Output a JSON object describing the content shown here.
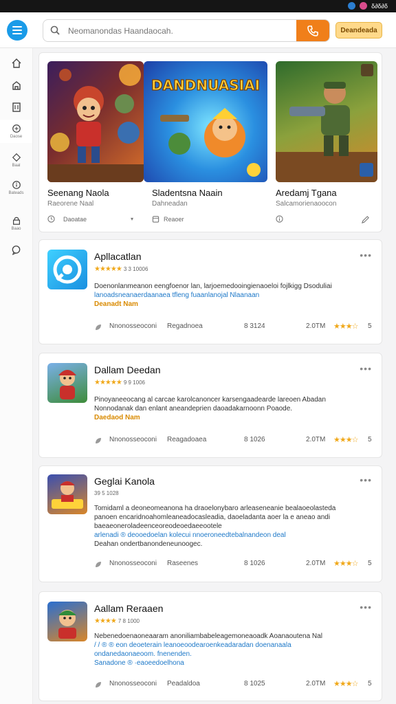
{
  "colors": {
    "accent": "#1a9be8",
    "search_button": "#f07f1a",
    "star": "#f0a81a",
    "link": "#1d78c8"
  },
  "status": {
    "right_text": "δ∂δ∂δ"
  },
  "search": {
    "placeholder": "Neomanondas Haandaocah.",
    "icon": "search-icon",
    "button_icon": "phone-icon"
  },
  "header": {
    "action_label": "Deandeada"
  },
  "sidebar": {
    "items": [
      {
        "icon": "home-icon",
        "label": ""
      },
      {
        "icon": "store-icon",
        "label": ""
      },
      {
        "icon": "library-icon",
        "label": ""
      },
      {
        "icon": "games-icon",
        "label": "Daose"
      },
      {
        "icon": "tag-icon",
        "label": "Baal"
      },
      {
        "icon": "info-icon",
        "label": "Bateads"
      },
      {
        "icon": "lock-icon",
        "label": "Baao"
      },
      {
        "icon": "chat-icon",
        "label": ""
      }
    ]
  },
  "featured": [
    {
      "title": "Seenang Naola",
      "subtitle": "Raeorene Naal",
      "meta": "Daoatae"
    },
    {
      "title": "Sladentsna Naain",
      "subtitle": "Dahneadan",
      "meta": "Reaoer",
      "banner_text": "DANDNUASIAI"
    },
    {
      "title": "Aredamj Tgana",
      "subtitle": "Salcamorienaoocon",
      "meta": ""
    }
  ],
  "apps": [
    {
      "name": "Apllacatlan",
      "rating_text": "3 3 10006",
      "desc": [
        "Doenonlanmeanon eengfoenor lan, larjoemedooingienaoeloi fojlkigg Dsoduliai",
        "lanoadsneanaerdaanaea tfleng fuaanlanojal Nlaanaan"
      ],
      "tag": "Deanadt Nam",
      "developer": "Nnonosseoconi",
      "category": "Regadnoea",
      "count": "8 3124",
      "size": "2.0TM",
      "score": "5"
    },
    {
      "name": "Dallam Deedan",
      "rating_text": "9 9 1006",
      "desc": [
        "Pinoyaneeocang al carcae karolcanoncer karsengaadearde lareoen Abadan",
        "Nonnodanak dan enlant aneandeprien daoadakarnoonn Poaode."
      ],
      "tag": "Daedaod Nam",
      "developer": "Nnonosseoconi",
      "category": "Reagadoaea",
      "count": "8 1026",
      "size": "2.0TM",
      "score": "5"
    },
    {
      "name": "Geglai Kanola",
      "rating_text": "39 5 1028",
      "desc": [
        "Tomidaml a deoneomeanona ha draoelonybaro arleaseneanie bealaoeolasteda",
        "panoen encaridnoahomleaneadocasleadia, daoeladanta aoer la e aneao andi",
        "baeaeoneroladeenceoreodeoedaeeootele",
        "arlenadi ® deooedoelan kolecui nnoeroneedtebalnandeon deal",
        "Deahan ondertbanondeneunoogec."
      ],
      "tag": "",
      "developer": "Nnonosseoconi",
      "category": "Raseenes",
      "count": "8 1026",
      "size": "2.0TM",
      "score": "5"
    },
    {
      "name": "Aallam Reraaen",
      "rating_text": "7 8 1000",
      "desc": [
        "Nebenedoenaoneaaram anoniliambabeleagemoneaoadk Aoanaoutena Nal",
        "/ / ® ® eon deoeterain leanoeoodearoenkeadaradan doenanaala",
        "ondanedaonaeoom. fnenenden."
      ],
      "tag": "Sanadone ® ·eaoeedoelhona",
      "developer": "Nnonosseoconi",
      "category": "Peadaldoa",
      "count": "8 1025",
      "size": "2.0TM",
      "score": "5"
    }
  ]
}
